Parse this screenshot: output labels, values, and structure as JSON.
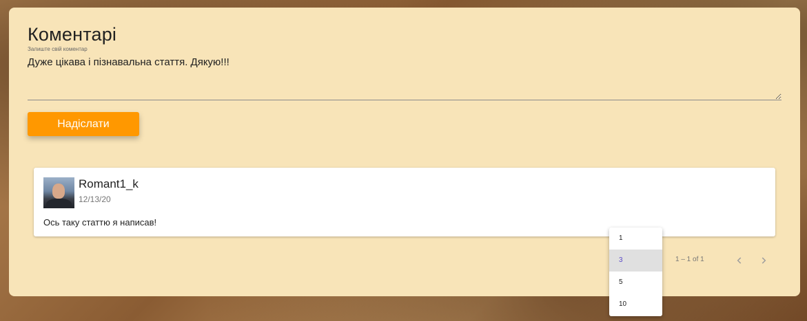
{
  "comments_section": {
    "title": "Коментарі",
    "input_label": "Залиште свій коментар",
    "input_value": "Дуже цікава і пізнавальна стаття. Дякую!!!",
    "submit_label": "Надіслати"
  },
  "comments": [
    {
      "author": "Romant1_k",
      "date": "12/13/20",
      "text": "Ось таку статтю я написав!"
    }
  ],
  "paginator": {
    "range_label": "1 – 1 of 1",
    "page_size_options": [
      "1",
      "3",
      "5",
      "10"
    ],
    "selected_page_size": "3"
  },
  "colors": {
    "card_background": "#f8e4b8",
    "button_accent": "#ff9800",
    "selected_option_text": "#5c4ac7"
  },
  "icons": {
    "prev": "chevron-left-icon",
    "next": "chevron-right-icon"
  }
}
